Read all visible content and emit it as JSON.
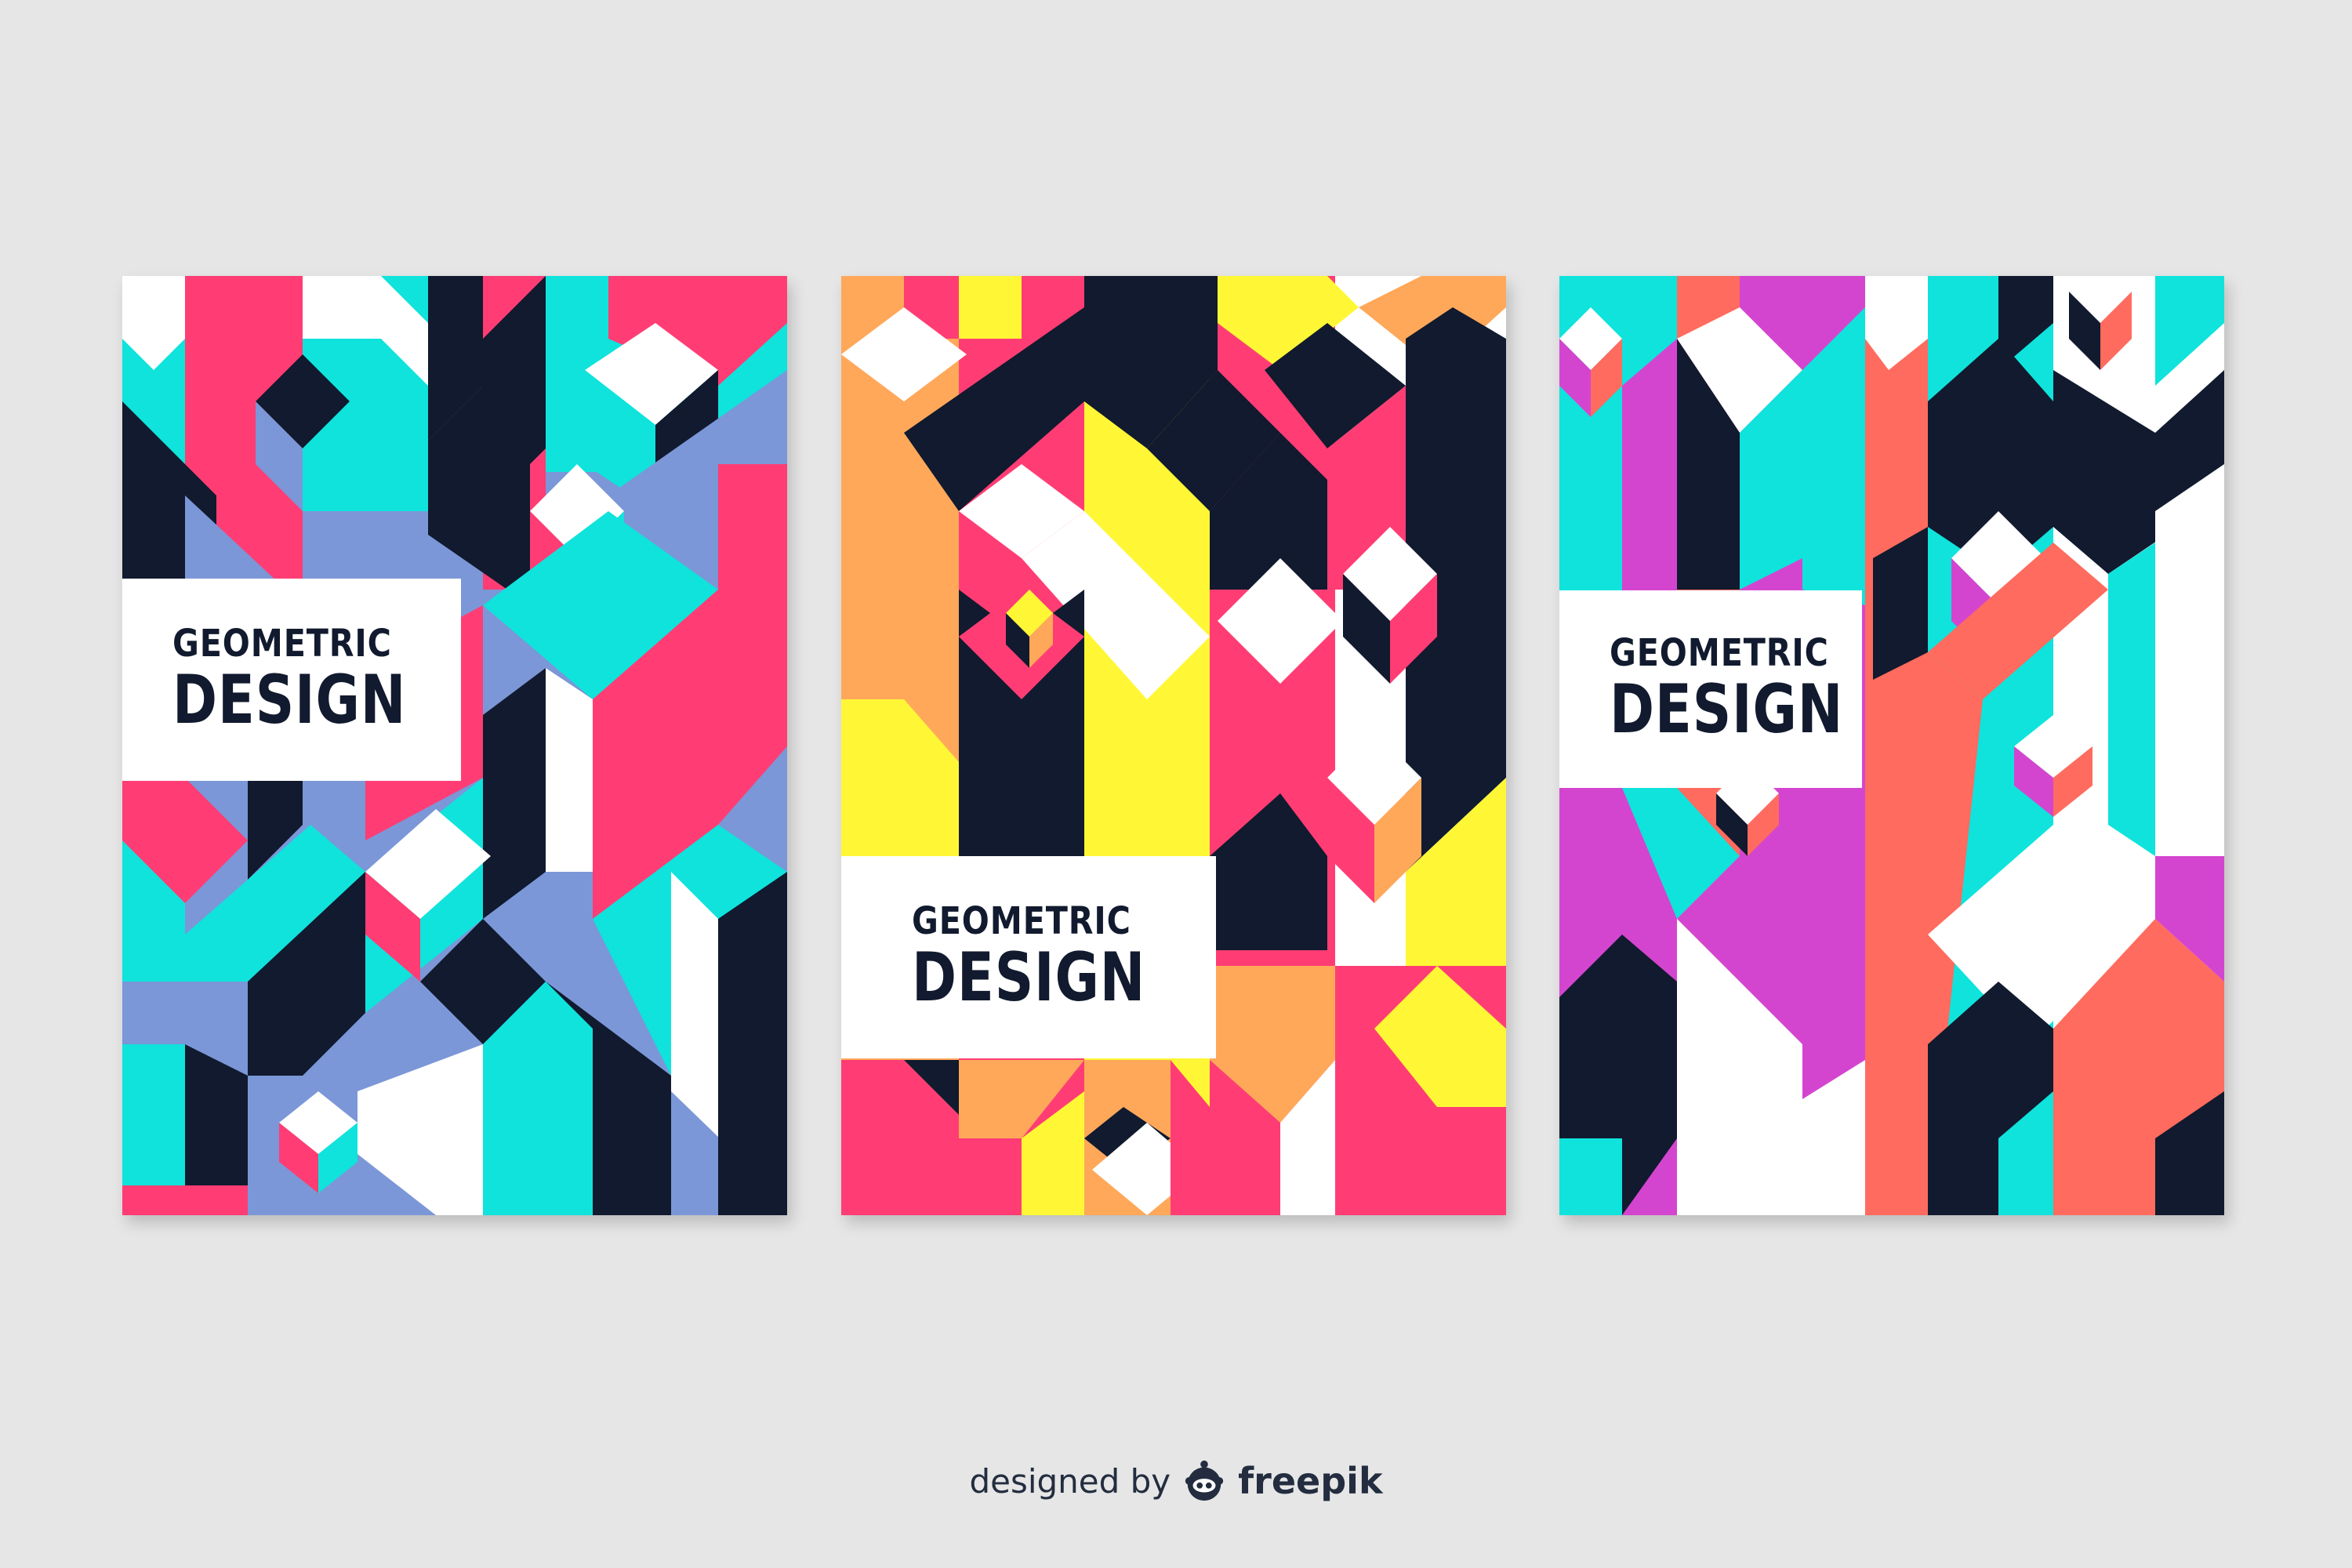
{
  "covers": [
    {
      "line1": "GEOMETRIC",
      "line2": "DESIGN"
    },
    {
      "line1": "GEOMETRIC",
      "line2": "DESIGN"
    },
    {
      "line1": "GEOMETRIC",
      "line2": "DESIGN"
    }
  ],
  "credit": {
    "prefix": "designed by",
    "brand": "freepik",
    "logo_icon": "freepik-logo-icon"
  },
  "colors": {
    "background": "#e6e6e6",
    "navy": "#111a2e",
    "pink": "#ff3d74",
    "cyan": "#0fe3dc",
    "periwinkle": "#7b97d7",
    "yellow": "#fff736",
    "orange": "#ffa85a",
    "coral": "#ff6b5e",
    "magenta": "#d445cf",
    "white": "#ffffff"
  }
}
